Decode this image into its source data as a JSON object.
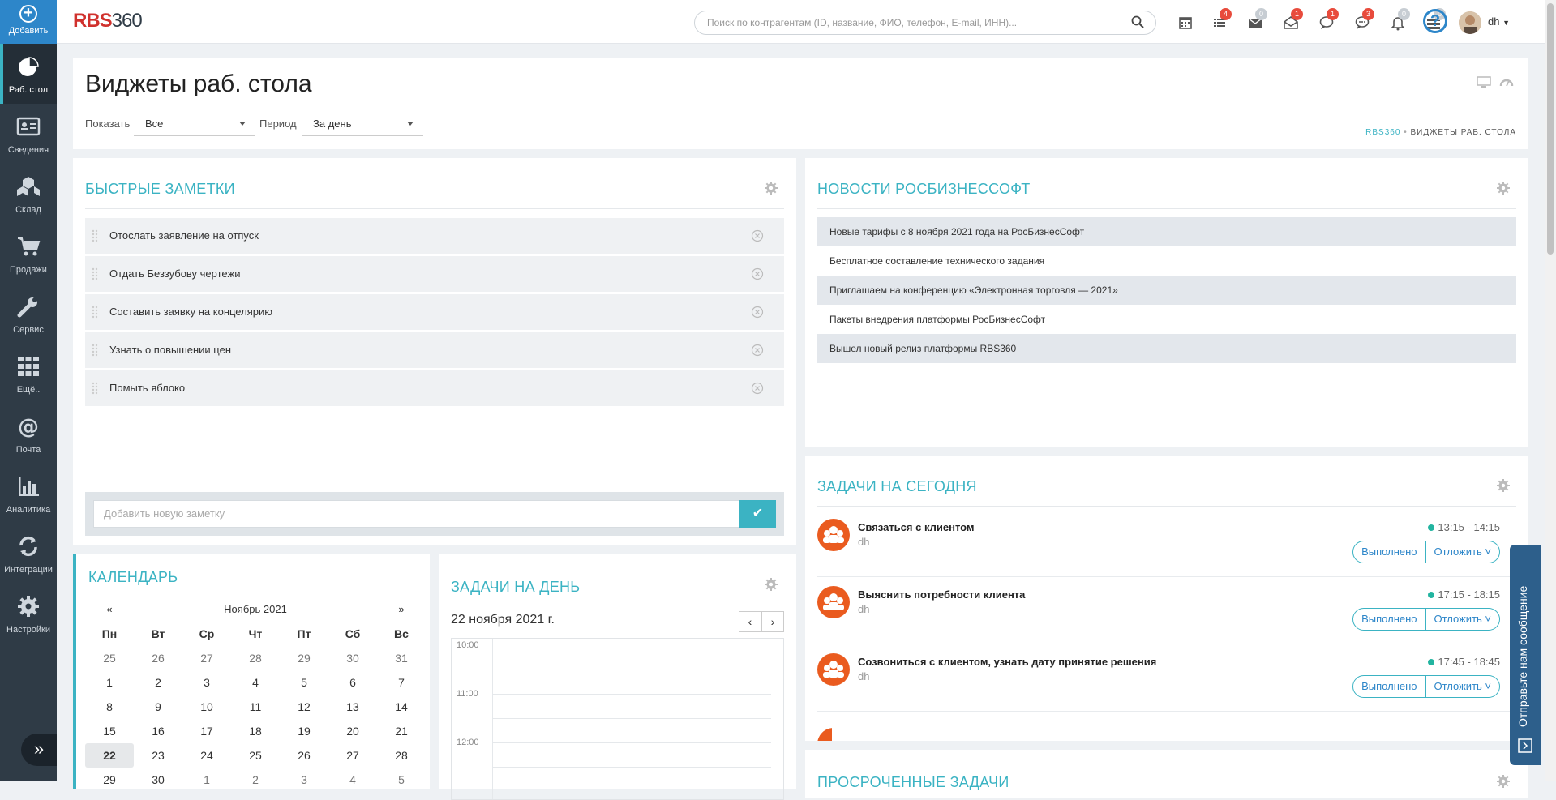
{
  "sidebar": {
    "add_label": "Добавить",
    "items": [
      {
        "label": "Раб. стол",
        "icon": "pie-chart-icon"
      },
      {
        "label": "Сведения",
        "icon": "id-card-icon"
      },
      {
        "label": "Склад",
        "icon": "boxes-icon"
      },
      {
        "label": "Продажи",
        "icon": "cart-icon"
      },
      {
        "label": "Сервис",
        "icon": "wrench-icon"
      },
      {
        "label": "Ещё..",
        "icon": "grid-icon"
      },
      {
        "label": "Почта",
        "icon": "at-icon"
      },
      {
        "label": "Аналитика",
        "icon": "bar-chart-icon"
      },
      {
        "label": "Интеграции",
        "icon": "sync-icon"
      },
      {
        "label": "Настройки",
        "icon": "gear-icon"
      }
    ],
    "expand_glyph": "»"
  },
  "topbar": {
    "logo_rbs": "RBS",
    "logo_num": "360",
    "search_placeholder": "Поиск по контрагентам (ID, название, ФИО, телефон, E-mail, ИНН)...",
    "badges": [
      "4",
      "0",
      "1",
      "1",
      "3",
      "0",
      "0"
    ],
    "help": "?",
    "user": "dh"
  },
  "page": {
    "title": "Виджеты раб. стола",
    "show_label": "Показать",
    "show_value": "Все",
    "period_label": "Период",
    "period_value": "За день",
    "crumb_home": "RBS360",
    "crumb_sep": "•",
    "crumb_current": "ВИДЖЕТЫ РАБ. СТОЛА"
  },
  "notes": {
    "title": "Быстрые заметки",
    "items": [
      "Отослать заявление на отпуск",
      "Отдать Беззубову чертежи",
      "Составить заявку на концелярию",
      "Узнать о повышении цен",
      "Помыть яблоко"
    ],
    "add_placeholder": "Добавить новую заметку",
    "ok_glyph": "✔"
  },
  "news": {
    "title": "Новости РосБизнесСофт",
    "items": [
      "Новые тарифы с 8 ноября 2021 года на РосБизнесСофт",
      "Бесплатное составление технического задания",
      "Приглашаем на конференцию «Электронная торговля — 2021»",
      "Пакеты внедрения платформы РосБизнесСофт",
      "Вышел новый релиз платформы RBS360"
    ]
  },
  "calendar": {
    "title": "Календарь",
    "prev": "«",
    "next": "»",
    "month": "Ноябрь 2021",
    "weekdays": [
      "Пн",
      "Вт",
      "Ср",
      "Чт",
      "Пт",
      "Сб",
      "Вс"
    ],
    "weeks": [
      [
        "25",
        "26",
        "27",
        "28",
        "29",
        "30",
        "31"
      ],
      [
        "1",
        "2",
        "3",
        "4",
        "5",
        "6",
        "7"
      ],
      [
        "8",
        "9",
        "10",
        "11",
        "12",
        "13",
        "14"
      ],
      [
        "15",
        "16",
        "17",
        "18",
        "19",
        "20",
        "21"
      ],
      [
        "22",
        "23",
        "24",
        "25",
        "26",
        "27",
        "28"
      ],
      [
        "29",
        "30",
        "1",
        "2",
        "3",
        "4",
        "5"
      ]
    ]
  },
  "day_tasks": {
    "title": "Задачи на день",
    "date": "22 ноября 2021 г.",
    "prev": "‹",
    "next": "›",
    "hours": [
      "10:00",
      "11:00",
      "12:00"
    ]
  },
  "today_tasks": {
    "title": "Задачи на сегодня",
    "done_label": "Выполнено",
    "postpone_label": "Отложить ˅",
    "items": [
      {
        "name": "Связаться с клиентом",
        "user": "dh",
        "time": "13:15 - 14:15"
      },
      {
        "name": "Выяснить потребности клиента",
        "user": "dh",
        "time": "17:15 - 18:15"
      },
      {
        "name": "Созвониться с клиентом, узнать дату принятие решения",
        "user": "dh",
        "time": "17:45 - 18:45"
      }
    ]
  },
  "overdue": {
    "title": "Просроченные задачи"
  },
  "feedback": {
    "label": "Отправьте нам сообщение"
  },
  "colors": {
    "accent": "#3bb3c3",
    "sidebar": "#2f3b46",
    "primary": "#2d86c9",
    "badge": "#e84b3c",
    "avatar": "#ea5b1f"
  }
}
